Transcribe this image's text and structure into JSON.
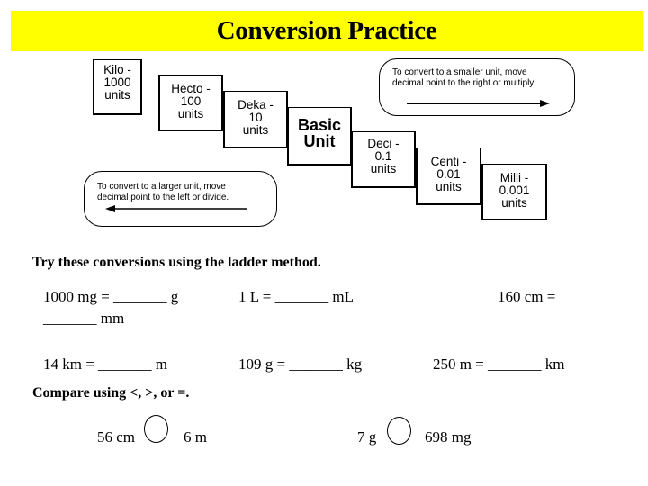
{
  "title": "Conversion Practice",
  "colors": {
    "title_bar": "#ffff00",
    "text": "#000000"
  },
  "ladder": {
    "steps": [
      {
        "prefix": "Kilo -",
        "value": "1000",
        "unit": "units"
      },
      {
        "prefix": "Hecto -",
        "value": "100",
        "unit": "units"
      },
      {
        "prefix": "Deka -",
        "value": "10",
        "unit": "units"
      },
      {
        "prefix": "Basic",
        "value": "Unit",
        "unit": ""
      },
      {
        "prefix": "Deci -",
        "value": "0.1",
        "unit": "units"
      },
      {
        "prefix": "Centi -",
        "value": "0.01",
        "unit": "units"
      },
      {
        "prefix": "Milli -",
        "value": "0.001",
        "unit": "units"
      }
    ],
    "note_smaller": {
      "line1": "To convert to a smaller unit, move",
      "line2": "decimal  point to the right or multiply.",
      "arrow": "arrow-right-icon"
    },
    "note_larger": {
      "line1": "To convert to a larger unit, move",
      "line2": "decimal  point to the left or divide.",
      "arrow": "arrow-left-icon"
    }
  },
  "conversions": {
    "heading": "Try these conversions using the ladder method.",
    "problems": [
      "1000 mg = _______ g",
      "1 L = _______ mL",
      "160 cm =",
      "_______ mm",
      "14 km = _______ m",
      "109 g = _______ kg",
      "250 m = _______ km"
    ]
  },
  "compare": {
    "heading": "Compare using <, >, or =.",
    "items": [
      {
        "left": "56 cm",
        "right": "6 m"
      },
      {
        "left": "7 g",
        "right": "698 mg"
      }
    ]
  }
}
